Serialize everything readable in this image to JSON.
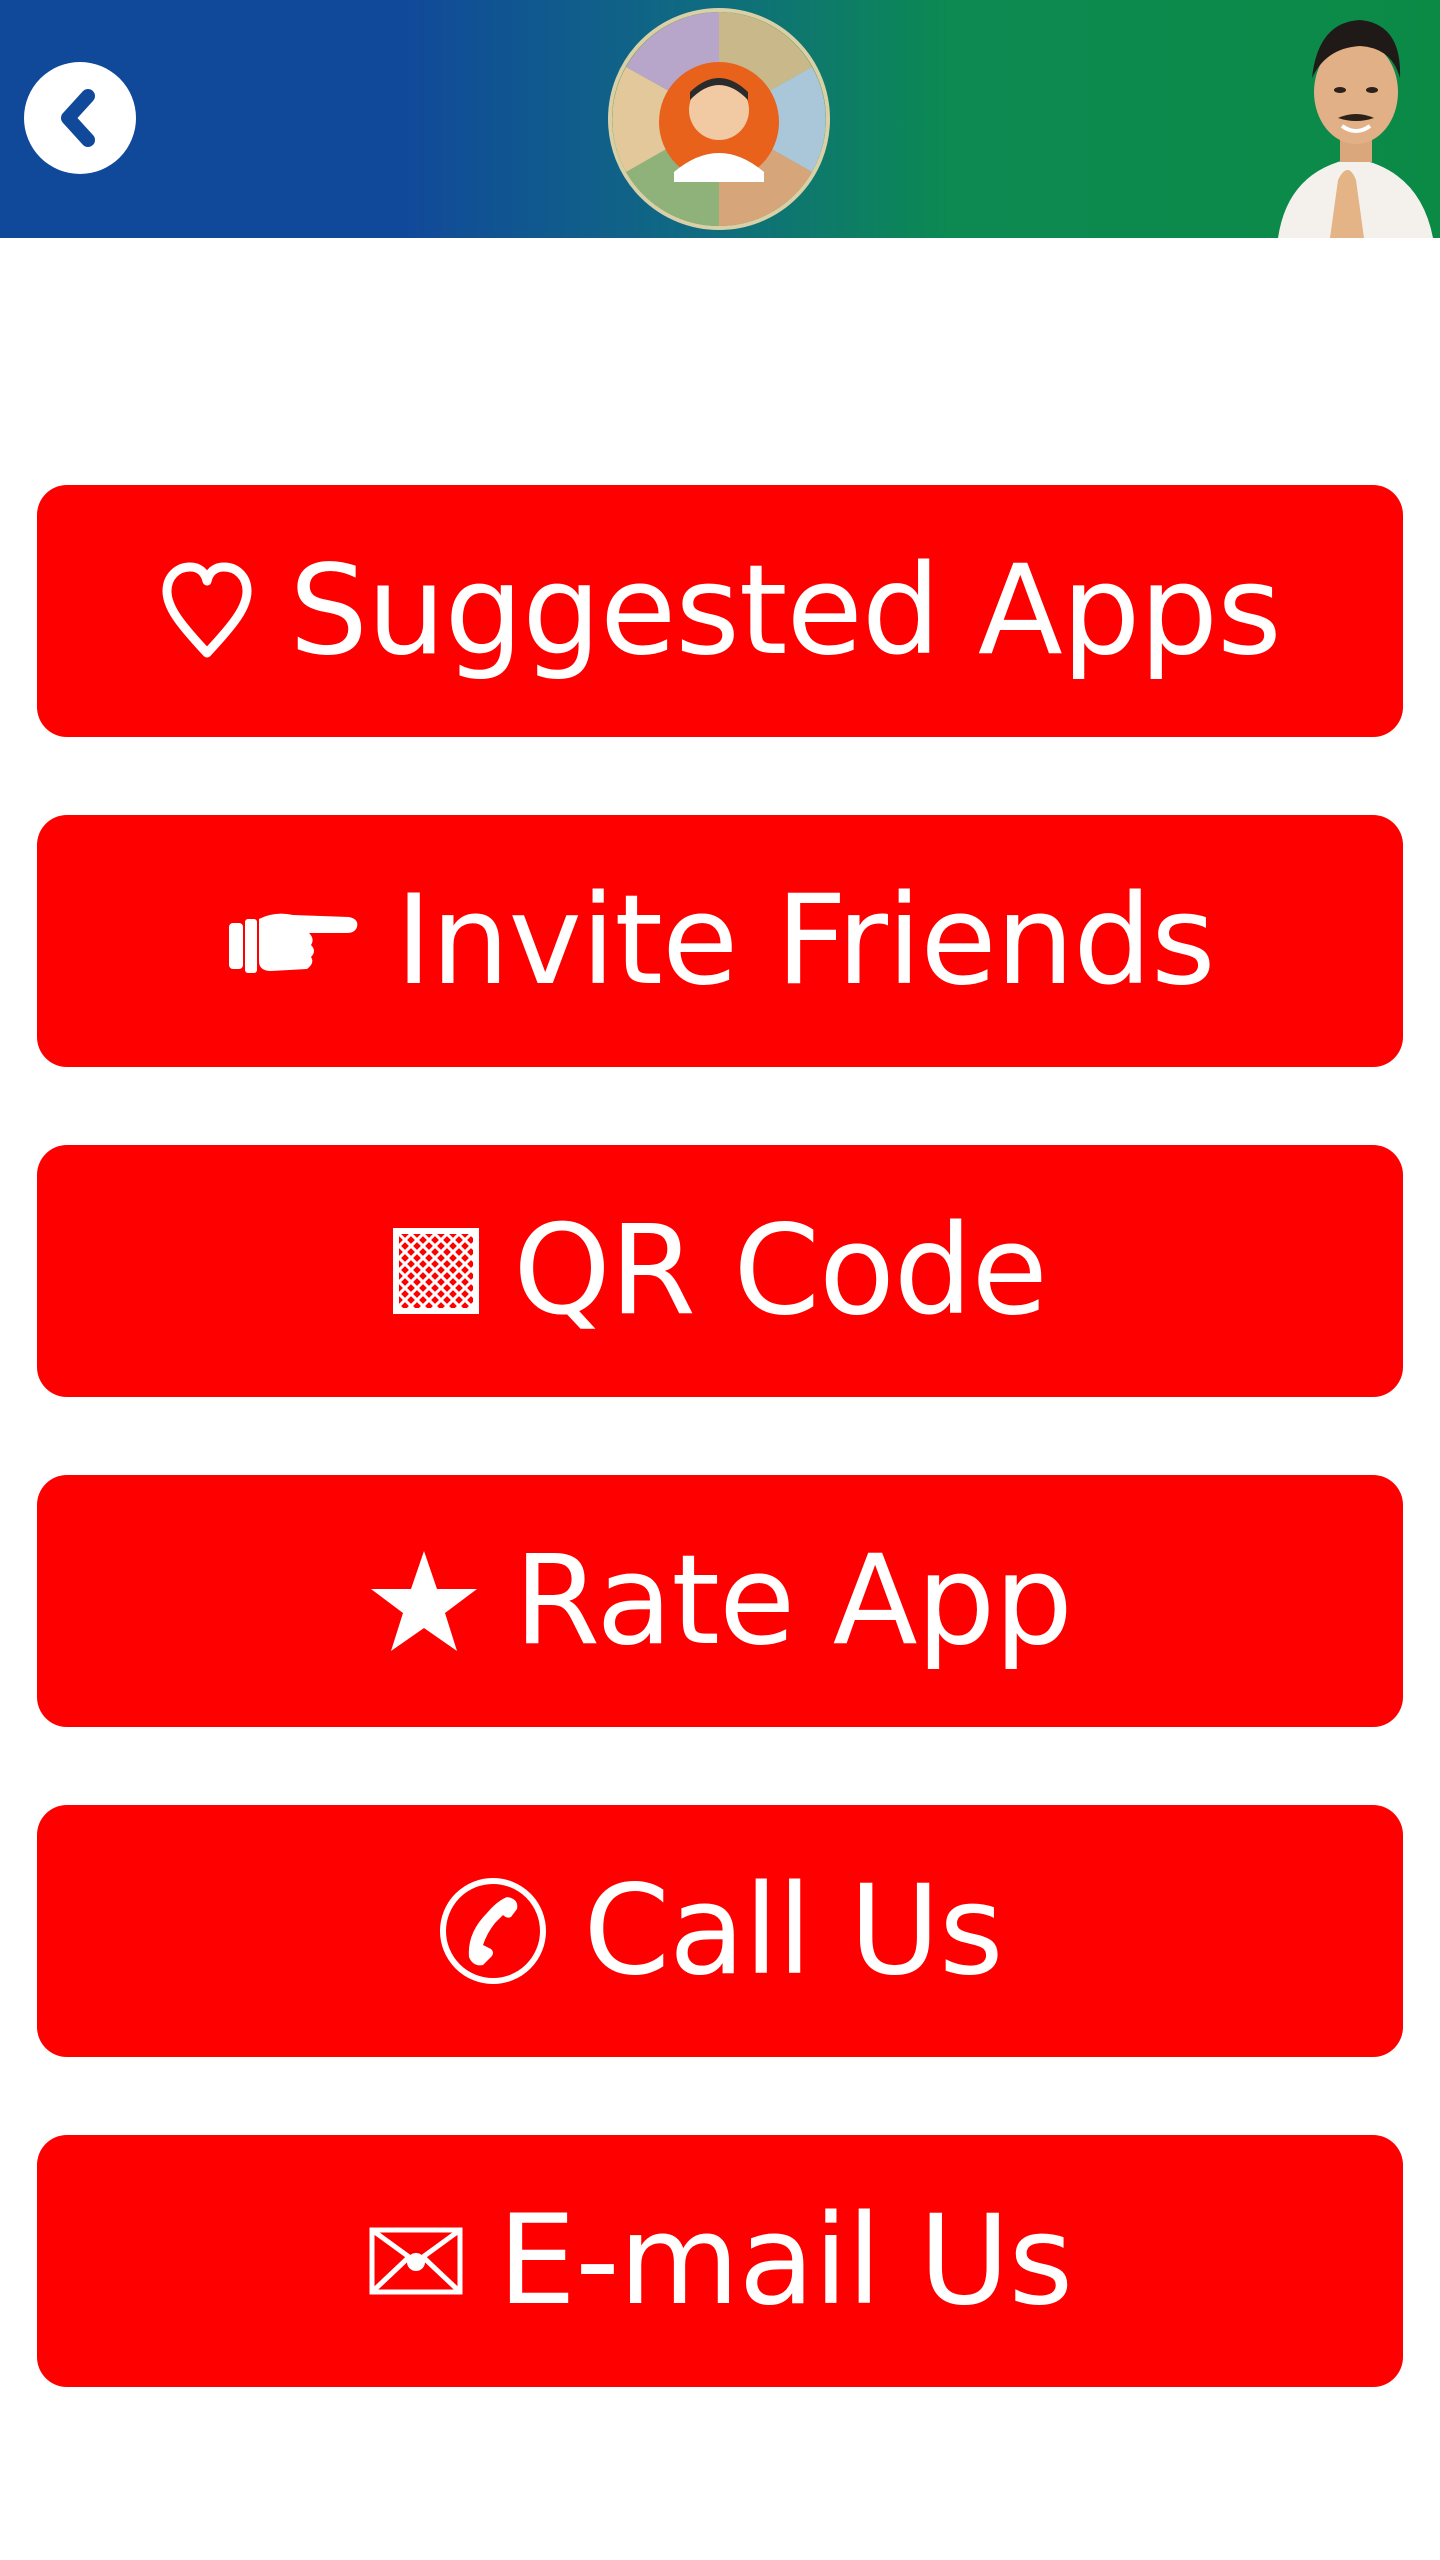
{
  "header": {
    "back_icon": "chevron-left-icon",
    "logo_icon": "party-emblem-logo",
    "portrait_icon": "leader-portrait-image",
    "colors": {
      "blue": "#11499a",
      "green": "#0b8a46"
    }
  },
  "menu": {
    "accent_color": "#ff0000",
    "items": [
      {
        "id": "suggested-apps",
        "icon": "heart-outline-icon",
        "label": "Suggested Apps"
      },
      {
        "id": "invite-friends",
        "icon": "pointing-hand-icon",
        "label": "Invite Friends"
      },
      {
        "id": "qr-code",
        "icon": "qr-code-icon",
        "label": "QR Code"
      },
      {
        "id": "rate-app",
        "icon": "star-icon",
        "label": "Rate App"
      },
      {
        "id": "call-us",
        "icon": "phone-circle-icon",
        "label": "Call Us"
      },
      {
        "id": "email-us",
        "icon": "envelope-icon",
        "label": "E-mail Us"
      }
    ]
  }
}
